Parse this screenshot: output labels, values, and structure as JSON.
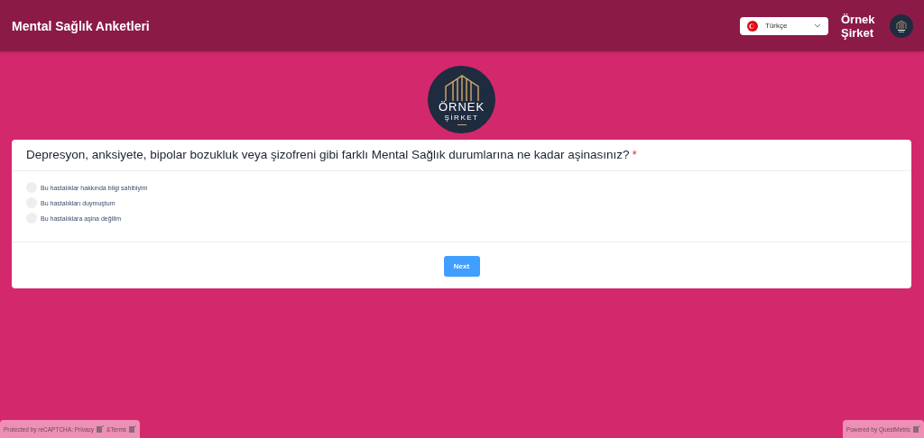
{
  "header": {
    "title": "Mental Sağlık Anketleri",
    "language": {
      "label": "Türkçe"
    },
    "company": "Örnek Şirket"
  },
  "logo": {
    "line1": "ÖRNEK",
    "line2": "ŞİRKET"
  },
  "question": {
    "text": "Depresyon, anksiyete, bipolar bozukluk veya şizofreni gibi farklı Mental Sağlık durumlarına ne kadar aşinasınız?",
    "required_mark": "*",
    "options": [
      {
        "label": "Bu hastalıklar hakkında bilgi sahibiyim",
        "selected": false
      },
      {
        "label": "Bu hastalıkları duymuştum",
        "selected": false
      },
      {
        "label": "Bu hastalıklara aşina değilim",
        "selected": false
      }
    ]
  },
  "next_button": "Next",
  "footer": {
    "recaptcha": "Protected by reCAPTCHA: Privacy",
    "terms": "&Terms",
    "powered": "Powered by QuestMetric"
  }
}
